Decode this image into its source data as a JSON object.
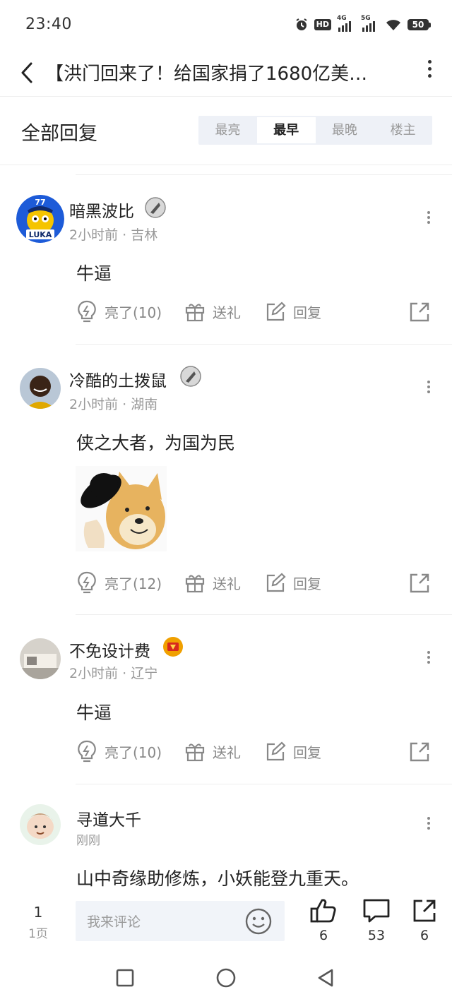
{
  "status_bar": {
    "time": "23:40",
    "hd_label": "HD",
    "net1": "4G",
    "net2": "5G",
    "battery": "50",
    "icons": [
      "alarm-icon",
      "hd-icon",
      "signal-4g-icon",
      "signal-5g-icon",
      "wifi-icon",
      "battery-icon"
    ]
  },
  "header": {
    "title": "【洪门回来了！给国家捐了1680亿美…"
  },
  "sort": {
    "title": "全部回复",
    "tabs": [
      {
        "label": "最亮",
        "active": false
      },
      {
        "label": "最早",
        "active": true
      },
      {
        "label": "最晚",
        "active": false
      },
      {
        "label": "楼主",
        "active": false
      }
    ]
  },
  "action_labels": {
    "gift": "送礼",
    "reply": "回复"
  },
  "comments": [
    {
      "username": "暗黑波比",
      "time": "2小时前",
      "location": "吉林",
      "meta": "2小时前 · 吉林",
      "text": "牛逼",
      "likes_label": "亮了(10)",
      "avatar_text": "LUKA",
      "avatar_number": "77"
    },
    {
      "username": "冷酷的土拨鼠",
      "time": "2小时前",
      "location": "湖南",
      "meta": "2小时前 · 湖南",
      "text": "侠之大者，为国为民",
      "likes_label": "亮了(12)",
      "has_image": true
    },
    {
      "username": "不免设计费",
      "time": "2小时前",
      "location": "辽宁",
      "meta": "2小时前 · 辽宁",
      "text": "牛逼",
      "likes_label": "亮了(10)"
    },
    {
      "username": "寻道大千",
      "meta": "刚刚",
      "text": "山中奇缘助修炼，小妖能登九重天。"
    }
  ],
  "bottom_bar": {
    "page_number": "1",
    "page_label": "1页",
    "comment_placeholder": "我来评论",
    "like_count": "6",
    "comment_count": "53",
    "share_count": "6"
  },
  "colors": {
    "text_primary": "#222222",
    "text_secondary": "#999999",
    "segment_bg": "#eef1f7",
    "input_bg": "#f1f4f9"
  }
}
